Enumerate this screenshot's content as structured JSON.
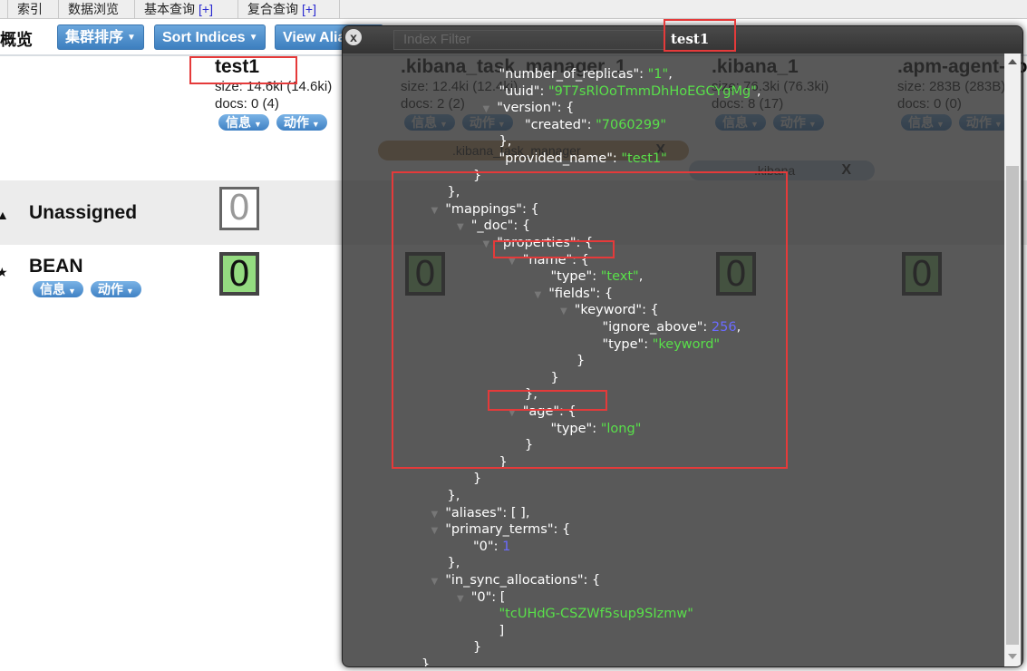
{
  "tabs": [
    {
      "label": "索引"
    },
    {
      "label": "数据浏览"
    },
    {
      "label": "基本查询",
      "plus": "[+]"
    },
    {
      "label": "复合查询",
      "plus": "[+]"
    }
  ],
  "header": {
    "title": "概览",
    "buttons": [
      {
        "label": "集群排序"
      },
      {
        "label": "Sort Indices"
      },
      {
        "label": "View Aliases"
      }
    ],
    "filter_placeholder": "Index Filter"
  },
  "indices": [
    {
      "name": "test1",
      "size": "size: 14.6ki (14.6ki)",
      "docs": "docs: 0 (4)",
      "info": "信息",
      "action": "动作"
    },
    {
      "name": ".kibana_task_manager_1",
      "size": "size: 12.4ki (12.4ki)",
      "docs": "docs: 2 (2)",
      "info": "信息",
      "action": "动作"
    },
    {
      "name": ".kibana_1",
      "size": "size: 76.3ki (76.3ki)",
      "docs": "docs: 8 (17)",
      "info": "信息",
      "action": "动作"
    },
    {
      "name": ".apm-agent-configuration",
      "size": "size: 283B (283B)",
      "docs": "docs: 0 (0)",
      "info": "信息",
      "action": "动作"
    }
  ],
  "aliases": [
    {
      "name": ".kibana_task_manager",
      "remove": "X",
      "color": "#c8a070"
    },
    {
      "name": ".kibana",
      "remove": "X",
      "color": "#b9cbe0"
    }
  ],
  "rows": {
    "unassigned": {
      "label": "Unassigned",
      "shard": "0"
    },
    "node": {
      "label": "BEAN",
      "info": "信息",
      "action": "动作",
      "shards": [
        "0",
        "0",
        "0",
        "0"
      ]
    }
  },
  "modal": {
    "title": "test1",
    "close": "x",
    "json_lines": [
      {
        "indent": 5,
        "tri": false,
        "parts": [
          [
            "k",
            "\"number_of_replicas\": "
          ],
          [
            "s",
            "\"1\""
          ],
          [
            "k",
            ","
          ]
        ]
      },
      {
        "indent": 5,
        "tri": false,
        "parts": [
          [
            "k",
            "\"uuid\": "
          ],
          [
            "s",
            "\"9T7sRlOoTmmDhHoEGCYgMg\""
          ],
          [
            "k",
            ","
          ]
        ]
      },
      {
        "indent": 5,
        "tri": true,
        "parts": [
          [
            "k",
            "\"version\": {"
          ]
        ]
      },
      {
        "indent": 6,
        "tri": false,
        "parts": [
          [
            "k",
            "\"created\": "
          ],
          [
            "s",
            "\"7060299\""
          ]
        ]
      },
      {
        "indent": 5,
        "tri": false,
        "parts": [
          [
            "k",
            "},"
          ]
        ]
      },
      {
        "indent": 5,
        "tri": false,
        "parts": [
          [
            "k",
            "\"provided_name\": "
          ],
          [
            "s",
            "\"test1\""
          ]
        ]
      },
      {
        "indent": 4,
        "tri": false,
        "parts": [
          [
            "k",
            "}"
          ]
        ]
      },
      {
        "indent": 3,
        "tri": false,
        "parts": [
          [
            "k",
            "},"
          ]
        ]
      },
      {
        "indent": 3,
        "tri": true,
        "parts": [
          [
            "k",
            "\"mappings\": {"
          ]
        ]
      },
      {
        "indent": 4,
        "tri": true,
        "parts": [
          [
            "k",
            "\"_doc\": {"
          ]
        ]
      },
      {
        "indent": 5,
        "tri": true,
        "parts": [
          [
            "k",
            "\"properties\": {"
          ]
        ]
      },
      {
        "indent": 6,
        "tri": true,
        "parts": [
          [
            "k",
            "\"name\": {"
          ]
        ]
      },
      {
        "indent": 7,
        "tri": false,
        "parts": [
          [
            "k",
            "\"type\": "
          ],
          [
            "s",
            "\"text\""
          ],
          [
            "k",
            ","
          ]
        ]
      },
      {
        "indent": 7,
        "tri": true,
        "parts": [
          [
            "k",
            "\"fields\": {"
          ]
        ]
      },
      {
        "indent": 8,
        "tri": true,
        "parts": [
          [
            "k",
            "\"keyword\": {"
          ]
        ]
      },
      {
        "indent": 9,
        "tri": false,
        "parts": [
          [
            "k",
            "\"ignore_above\": "
          ],
          [
            "n",
            "256"
          ],
          [
            "k",
            ","
          ]
        ]
      },
      {
        "indent": 9,
        "tri": false,
        "parts": [
          [
            "k",
            "\"type\": "
          ],
          [
            "s",
            "\"keyword\""
          ]
        ]
      },
      {
        "indent": 8,
        "tri": false,
        "parts": [
          [
            "k",
            "}"
          ]
        ]
      },
      {
        "indent": 7,
        "tri": false,
        "parts": [
          [
            "k",
            "}"
          ]
        ]
      },
      {
        "indent": 6,
        "tri": false,
        "parts": [
          [
            "k",
            "},"
          ]
        ]
      },
      {
        "indent": 6,
        "tri": true,
        "parts": [
          [
            "k",
            "\"age\": {"
          ]
        ]
      },
      {
        "indent": 7,
        "tri": false,
        "parts": [
          [
            "k",
            "\"type\": "
          ],
          [
            "s",
            "\"long\""
          ]
        ]
      },
      {
        "indent": 6,
        "tri": false,
        "parts": [
          [
            "k",
            "}"
          ]
        ]
      },
      {
        "indent": 5,
        "tri": false,
        "parts": [
          [
            "k",
            "}"
          ]
        ]
      },
      {
        "indent": 4,
        "tri": false,
        "parts": [
          [
            "k",
            "}"
          ]
        ]
      },
      {
        "indent": 3,
        "tri": false,
        "parts": [
          [
            "k",
            "},"
          ]
        ]
      },
      {
        "indent": 3,
        "tri": true,
        "parts": [
          [
            "k",
            "\"aliases\": [ ],"
          ]
        ]
      },
      {
        "indent": 3,
        "tri": true,
        "parts": [
          [
            "k",
            "\"primary_terms\": {"
          ]
        ]
      },
      {
        "indent": 4,
        "tri": false,
        "parts": [
          [
            "k",
            "\"0\": "
          ],
          [
            "n",
            "1"
          ]
        ]
      },
      {
        "indent": 3,
        "tri": false,
        "parts": [
          [
            "k",
            "},"
          ]
        ]
      },
      {
        "indent": 3,
        "tri": true,
        "parts": [
          [
            "k",
            "\"in_sync_allocations\": {"
          ]
        ]
      },
      {
        "indent": 4,
        "tri": true,
        "parts": [
          [
            "k",
            "\"0\": ["
          ]
        ]
      },
      {
        "indent": 5,
        "tri": false,
        "parts": [
          [
            "s",
            "\"tcUHdG-CSZWf5sup9SIzmw\""
          ]
        ]
      },
      {
        "indent": 5,
        "tri": false,
        "parts": [
          [
            "k",
            "]"
          ]
        ]
      },
      {
        "indent": 4,
        "tri": false,
        "parts": [
          [
            "k",
            "}"
          ]
        ]
      },
      {
        "indent": 2,
        "tri": false,
        "parts": [
          [
            "k",
            "}"
          ]
        ]
      }
    ]
  },
  "colors": {
    "json_string": "#59e04a",
    "json_number": "#6b6bff",
    "annotation": "#e53a3a",
    "shard_started": "#94db80",
    "button_blue": "#3d7fbf"
  }
}
